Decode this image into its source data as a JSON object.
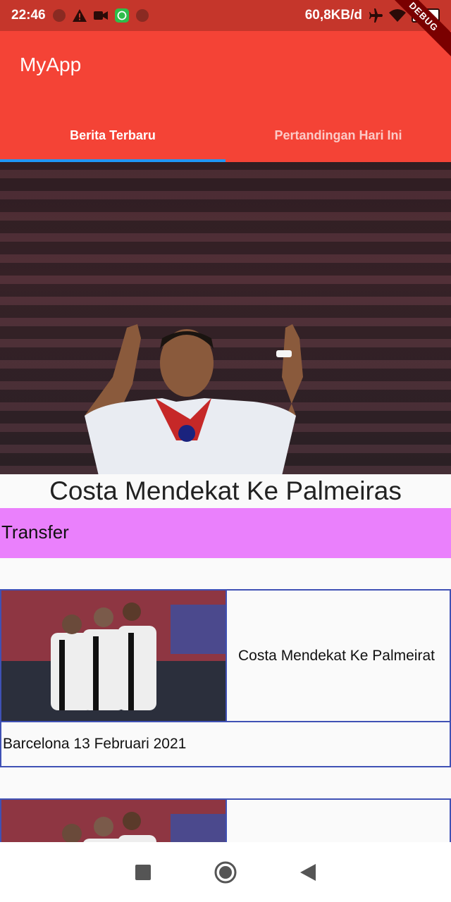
{
  "status_bar": {
    "time": "22:46",
    "network_speed": "60,8KB/d",
    "battery": "91",
    "debug_label": "DEBUG"
  },
  "app_bar": {
    "title": "MyApp",
    "tabs": [
      {
        "label": "Berita Terbaru",
        "selected": true
      },
      {
        "label": "Pertandingan Hari Ini",
        "selected": false
      }
    ]
  },
  "featured": {
    "headline": "Costa Mendekat Ke Palmeiras",
    "category": "Transfer"
  },
  "news_items": [
    {
      "title": "Costa Mendekat Ke Palmeirat",
      "date": "Barcelona 13 Februari 2021"
    },
    {
      "title": "",
      "date": ""
    }
  ],
  "colors": {
    "status_bar": "#c5362b",
    "app_bar": "#f44336",
    "tab_indicator": "#2196f3",
    "category_bg": "#ea80fc",
    "card_border": "#3f51b5"
  }
}
